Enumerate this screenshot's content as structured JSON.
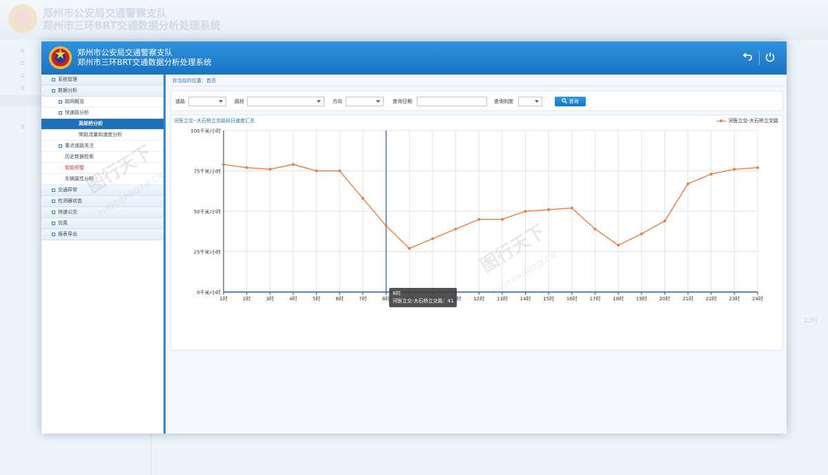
{
  "background": {
    "title_line1": "郑州市公安局交通警察支队",
    "title_line2": "郑州市三环BRT交通数据分析处理系统",
    "x_tick": "22时"
  },
  "header": {
    "title_line1": "郑州市公安局交通警察支队",
    "title_line2": "郑州市三环BRT交通数据分析处理系统",
    "back_icon": "back-arrow-icon",
    "power_icon": "power-icon"
  },
  "sidebar": {
    "items": [
      {
        "label": "系统管理",
        "level": 1
      },
      {
        "label": "数据分析",
        "level": 1
      },
      {
        "label": "路网概览",
        "level": 2
      },
      {
        "label": "快速路分析",
        "level": 2
      },
      {
        "label": "高架桥分析",
        "level": 3,
        "active": true
      },
      {
        "label": "常路流量和速度分析",
        "level": 3
      },
      {
        "label": "重点道路关注",
        "level": 2
      },
      {
        "label": "历史数据检索",
        "level": 2
      },
      {
        "label": "智能预警",
        "level": 2,
        "warn": true
      },
      {
        "label": "车辆属性分析",
        "level": 2
      },
      {
        "label": "交通异常",
        "level": 1
      },
      {
        "label": "检测器状态",
        "level": 1
      },
      {
        "label": "快速公交",
        "level": 1
      },
      {
        "label": "仿真",
        "level": 1
      },
      {
        "label": "报表导出",
        "level": 1
      }
    ]
  },
  "breadcrumb": "你当前的位置：首页",
  "filters": {
    "road_label": "道路",
    "section_label": "路段",
    "direction_label": "方向",
    "date_label": "查询日期",
    "scale_label": "查询刻度",
    "query_button": "查询"
  },
  "panel": {
    "title": "河医立交--大石桥立交路段日速度汇总",
    "legend": "河医立交-大石桥立交路"
  },
  "tooltip": {
    "line1": "8时",
    "line2": "河医立交-大石桥立交路：41"
  },
  "watermark": {
    "text": "图行天下",
    "url": "PHOTOPHOTO.CN"
  },
  "colors": {
    "header": "#1f7ccc",
    "series": "#ef7a3c",
    "active_menu": "#1f6fb9"
  },
  "chart_data": {
    "type": "line",
    "categories": [
      "1时",
      "2时",
      "3时",
      "4时",
      "5时",
      "6时",
      "7时",
      "8时",
      "9时",
      "10时",
      "11时",
      "12时",
      "13时",
      "14时",
      "15时",
      "16时",
      "17时",
      "18时",
      "19时",
      "20时",
      "21时",
      "22时",
      "23时",
      "24时"
    ],
    "series": [
      {
        "name": "河医立交-大石桥立交路",
        "values": [
          79,
          77,
          76,
          79,
          75,
          75,
          58,
          41,
          27,
          33,
          39,
          45,
          45,
          50,
          51,
          52,
          39,
          29,
          36,
          44,
          67,
          73,
          76,
          77
        ]
      }
    ],
    "y_ticks": [
      "0千米/小时",
      "25千米/小时",
      "50千米/小时",
      "75千米/小时",
      "100千米/小时"
    ],
    "ylim": [
      0,
      100
    ],
    "grid": true,
    "legend_position": "top-right",
    "highlight_category": "8时"
  }
}
